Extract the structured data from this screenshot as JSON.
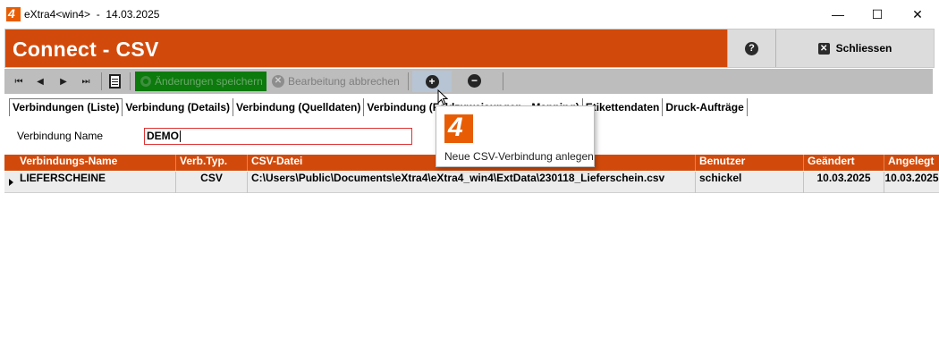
{
  "window": {
    "title": "eXtra4<win4>  -  14.03.2025",
    "logo_glyph": "4",
    "min_glyph": "—",
    "max_glyph": "☐",
    "close_glyph": "✕"
  },
  "header": {
    "title": "Connect - CSV",
    "help_glyph": "?",
    "close_label": "Schliessen",
    "close_glyph": "✕"
  },
  "toolbar": {
    "nav_first_glyph": "⏮",
    "nav_prev_glyph": "◀",
    "nav_next_glyph": "▶",
    "nav_last_glyph": "⏭",
    "save_label": "Änderungen speichern",
    "cancel_label": "Bearbeitung abbrechen",
    "cancel_glyph": "✕",
    "add_glyph": "+",
    "remove_glyph": "−"
  },
  "tabs": [
    {
      "label": "Verbindungen (Liste)",
      "active": true
    },
    {
      "label": "Verbindung (Details)",
      "active": false
    },
    {
      "label": "Verbindung (Quelldaten)",
      "active": false
    },
    {
      "label": "Verbindung (Feldzuweisungen - Mapping)",
      "active": false
    },
    {
      "label": "Etikettendaten",
      "active": false
    },
    {
      "label": "Druck-Aufträge",
      "active": false
    }
  ],
  "filter": {
    "label": "Verbindung Name",
    "value": "DEMO"
  },
  "table": {
    "columns": [
      "Verbindungs-Name",
      "Verb.Typ.",
      "CSV-Datei",
      "Benutzer",
      "Geändert",
      "Angelegt"
    ],
    "rows": [
      [
        "LIEFERSCHEINE",
        "CSV",
        "C:\\Users\\Public\\Documents\\eXtra4\\eXtra4_win4\\ExtData\\230118_Lieferschein.csv",
        "schickel",
        "10.03.2025",
        "10.03.2025"
      ]
    ]
  },
  "tooltip": {
    "logo_glyph": "4",
    "text": "Neue CSV-Verbindung anlegen"
  },
  "colors": {
    "brand_orange": "#d24a0b",
    "save_green": "#0c7a0c"
  }
}
